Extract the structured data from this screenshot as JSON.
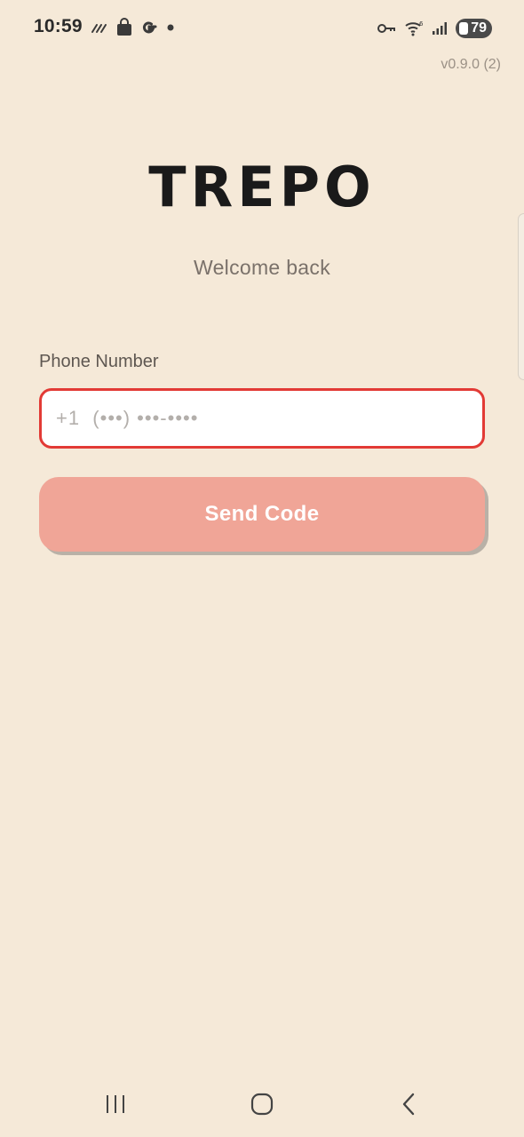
{
  "status_bar": {
    "time": "10:59",
    "battery_level": "79",
    "left_icons": [
      "stripe-icon",
      "shopping-bag-icon",
      "google-g-icon",
      "dot-icon"
    ],
    "right_icons": [
      "vpn-key-icon",
      "wifi-icon",
      "signal-icon",
      "battery-icon"
    ]
  },
  "app": {
    "version": "v0.9.0 (2)",
    "logo": "TREPO",
    "subtitle": "Welcome back"
  },
  "form": {
    "phone_label": "Phone Number",
    "phone_value": "",
    "phone_placeholder": "+1  (•••) •••-••••",
    "send_button_label": "Send Code"
  },
  "colors": {
    "background": "#f5e9d8",
    "accent_button": "#f0a597",
    "input_border_focus": "#e23a35"
  },
  "nav_bar": {
    "icons": [
      "recents-icon",
      "home-icon",
      "back-icon"
    ]
  }
}
